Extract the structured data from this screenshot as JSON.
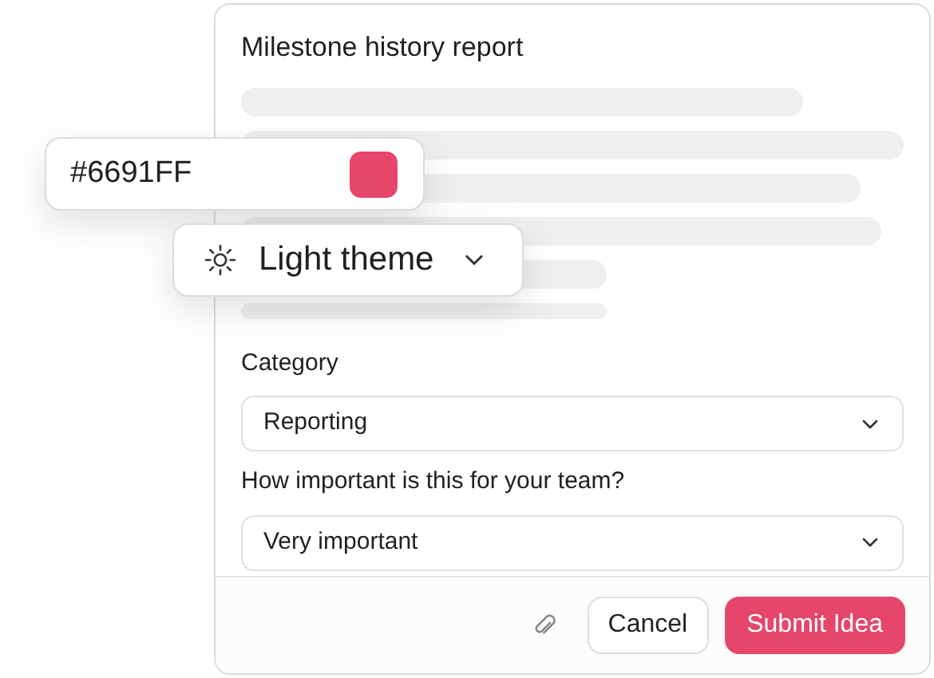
{
  "form": {
    "title": "Milestone history report",
    "fields": [
      {
        "label": "Category",
        "value": "Reporting"
      },
      {
        "label": "How important is this for your team?",
        "value": "Very important"
      }
    ],
    "buttons": [
      {
        "label": "Cancel",
        "kind": "secondary"
      },
      {
        "label": "Submit Idea",
        "kind": "primary"
      }
    ]
  },
  "color_popover": {
    "value": "#6691FF",
    "swatch": {
      "color": "#e5466a"
    }
  },
  "theme_popover": {
    "label": "Light theme"
  }
}
